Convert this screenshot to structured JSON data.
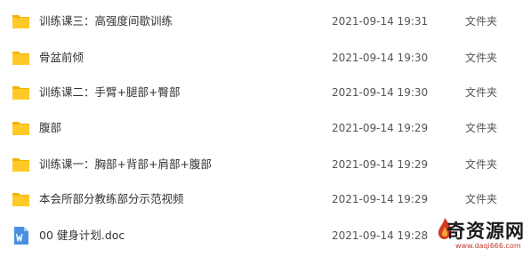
{
  "files": [
    {
      "name": "训练课三：高强度间歇训练",
      "modified": "2021-09-14 19:31",
      "type": "文件夹",
      "icon": "folder-icon"
    },
    {
      "name": "骨盆前倾",
      "modified": "2021-09-14 19:30",
      "type": "文件夹",
      "icon": "folder-icon"
    },
    {
      "name": "训练课二：手臂+腿部+臀部",
      "modified": "2021-09-14 19:30",
      "type": "文件夹",
      "icon": "folder-icon"
    },
    {
      "name": "腹部",
      "modified": "2021-09-14 19:29",
      "type": "文件夹",
      "icon": "folder-icon"
    },
    {
      "name": "训练课一：胸部+背部+肩部+腹部",
      "modified": "2021-09-14 19:29",
      "type": "文件夹",
      "icon": "folder-icon"
    },
    {
      "name": "本会所部分教练部分示范视频",
      "modified": "2021-09-14 19:29",
      "type": "文件夹",
      "icon": "folder-icon"
    },
    {
      "name": "00  健身计划.doc",
      "modified": "2021-09-14 19:28",
      "type": "",
      "icon": "word-doc-icon"
    }
  ],
  "watermark": {
    "text": "奇资源网",
    "url": "www.daqi666.com"
  },
  "colors": {
    "folder_body": "#FFCA28",
    "folder_tab": "#F4B400",
    "doc_blue": "#4A90E2"
  }
}
